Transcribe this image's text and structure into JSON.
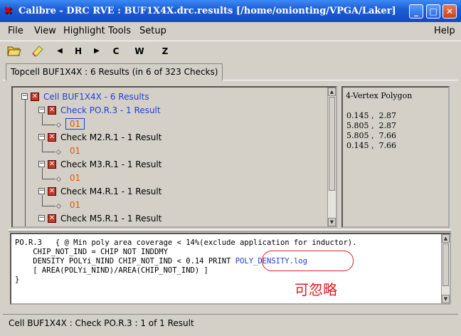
{
  "window": {
    "title": "Calibre - DRC RVE : BUF1X4X.drc.results [/home/onionting/VPGA/Laker]",
    "app_icon": "calibre-x-icon",
    "minimize": "_",
    "maximize": "□",
    "close": "✕"
  },
  "menu": {
    "file": "File",
    "view": "View",
    "highlight": "Highlight",
    "tools": "Tools",
    "setup": "Setup",
    "help": "Help"
  },
  "toolbar": {
    "open_icon": "folder-open-icon",
    "clear_icon": "eraser-icon",
    "prev_icon": "triangle-left-icon",
    "prev_label": "◀",
    "h_label": "H",
    "next_label": "▶",
    "c_label": "C",
    "w_label": "W",
    "z_label": "Z"
  },
  "tab": {
    "label": "Topcell BUF1X4X : 6 Results (in 6 of 323 Checks)"
  },
  "tree": {
    "root": {
      "label": "Cell BUF1X4X - 6 Results",
      "toggle": "−",
      "mark": "✕"
    },
    "checks": [
      {
        "label": "Check PO.R.3 - 1 Result",
        "result": "01",
        "toggle": "−",
        "mark": "✕"
      },
      {
        "label": "Check M2.R.1 - 1 Result",
        "result": "01",
        "toggle": "−",
        "mark": "✕"
      },
      {
        "label": "Check M3.R.1 - 1 Result",
        "result": "01",
        "toggle": "−",
        "mark": "✕"
      },
      {
        "label": "Check M4.R.1 - 1 Result",
        "result": "01",
        "toggle": "−",
        "mark": "✕"
      },
      {
        "label": "Check M5.R.1 - 1 Result",
        "toggle": "−",
        "mark": "✕"
      }
    ],
    "diamond": "◇"
  },
  "info": {
    "title": "4-Vertex Polygon",
    "coords": [
      "0.145 ,  2.87",
      "5.805 ,  2.87",
      "5.805 ,  7.66",
      "0.145 ,  7.66"
    ]
  },
  "code": {
    "line1": "PO.R.3   { @ Min poly area coverage < 14%(exclude application for inductor).",
    "line2": "    CHIP_NOT_IND = CHIP NOT INDDMY",
    "line3a": "    DENSITY POLYi_NIND CHIP_NOT_IND < 0.14 PRINT ",
    "line3b": "POLY_DENSITY.log",
    "line4": "    [ AREA(POLYi_NIND)/AREA(CHIP_NOT_IND) ]",
    "line5": "}",
    "annotation": "可忽略"
  },
  "status": {
    "text": "Cell BUF1X4X : Check PO.R.3 : 1 of 1 Result"
  },
  "colors": {
    "titlebar": "#1e5fd8",
    "link": "#1f3fd6",
    "result": "#e05a00",
    "annotation": "#e02020"
  }
}
